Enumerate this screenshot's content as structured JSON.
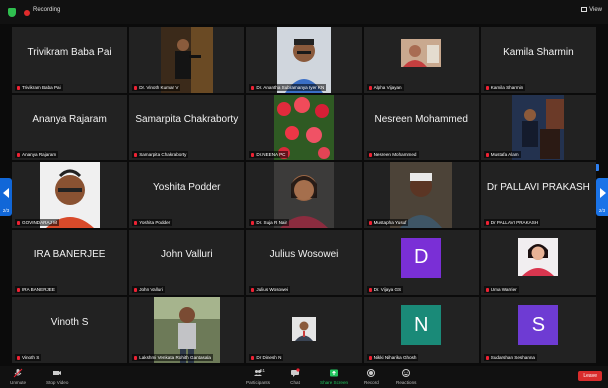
{
  "top": {
    "recording": "Recording",
    "view": "View"
  },
  "pager": {
    "left": "2/3",
    "right": "2/3"
  },
  "tiles": [
    {
      "name": "Trivikram Baba Pai",
      "big": "Trivikram Baba Pai",
      "kind": "text"
    },
    {
      "name": "Dr. Vinoth Kumar V",
      "kind": "photo",
      "photo": "speaker"
    },
    {
      "name": "Dr. Anantha Subramanya Iyer KN",
      "kind": "photo",
      "photo": "man-blue"
    },
    {
      "name": "Alpha Vijayan",
      "kind": "photo",
      "photo": "small"
    },
    {
      "name": "Kamila Sharmin",
      "big": "Kamila Sharmin",
      "kind": "text"
    },
    {
      "name": "Ananya Rajaram",
      "big": "Ananya Rajaram",
      "kind": "text"
    },
    {
      "name": "Samarpita Chakraborty",
      "big": "Samarpita Chakraborty",
      "kind": "text"
    },
    {
      "name": "Dr.NEENA PC",
      "kind": "photo",
      "photo": "tulips"
    },
    {
      "name": "Nesreen Mohammed",
      "big": "Nesreen Mohammed",
      "kind": "text"
    },
    {
      "name": "Mustafa Alam",
      "kind": "photo",
      "photo": "podium"
    },
    {
      "name": "GOVINDARAJ M",
      "kind": "photo",
      "photo": "man-smile"
    },
    {
      "name": "Yoshita Podder",
      "big": "Yoshita Podder",
      "kind": "text"
    },
    {
      "name": "Dr. Suja R Nair",
      "kind": "photo",
      "photo": "woman"
    },
    {
      "name": "Mustapha Yusuf",
      "kind": "photo",
      "photo": "cap"
    },
    {
      "name": "Dr PALLAVI PRAKASH",
      "big": "Dr PALLAVI PRAKASH",
      "kind": "text"
    },
    {
      "name": "IRA BANERJEE",
      "big": "IRA BANERJEE",
      "kind": "text"
    },
    {
      "name": "John Valluri",
      "big": "John Valluri",
      "kind": "text"
    },
    {
      "name": "Julius Wosowei",
      "big": "Julius Wosowei",
      "kind": "text"
    },
    {
      "name": "Dr. Vijaya GS",
      "kind": "avatar",
      "letter": "D",
      "color": "#7a2fd6"
    },
    {
      "name": "Uma Warrier",
      "kind": "photo",
      "photo": "woman2"
    },
    {
      "name": "Vinoth S",
      "big": "Vinoth S",
      "kind": "text"
    },
    {
      "name": "Lakshmi Venkata Rohith Gantasala",
      "kind": "photo",
      "photo": "outdoor"
    },
    {
      "name": "Dr Dinesh N",
      "kind": "photo",
      "photo": "tinyportrait"
    },
    {
      "name": "Nikki Niharika Ghosh",
      "kind": "avatar",
      "letter": "N",
      "color": "#1a8a78"
    },
    {
      "name": "Sudarshan Seshanna",
      "kind": "avatar",
      "letter": "S",
      "color": "#6e3bd3"
    }
  ],
  "controls": [
    {
      "label": "Unmute",
      "icon": "mic-icon"
    },
    {
      "label": "Stop Video",
      "icon": "video-icon"
    },
    {
      "label": "Participants",
      "icon": "participants-icon",
      "count": "51"
    },
    {
      "label": "Chat",
      "icon": "chat-icon"
    },
    {
      "label": "Share Screen",
      "icon": "share-screen-icon"
    },
    {
      "label": "Record",
      "icon": "record-icon"
    },
    {
      "label": "Reactions",
      "icon": "reactions-icon"
    }
  ],
  "leave": "Leave",
  "colors": {
    "share": "#22c55e",
    "leave": "#d92c2c",
    "accent": "#1a73e8"
  }
}
